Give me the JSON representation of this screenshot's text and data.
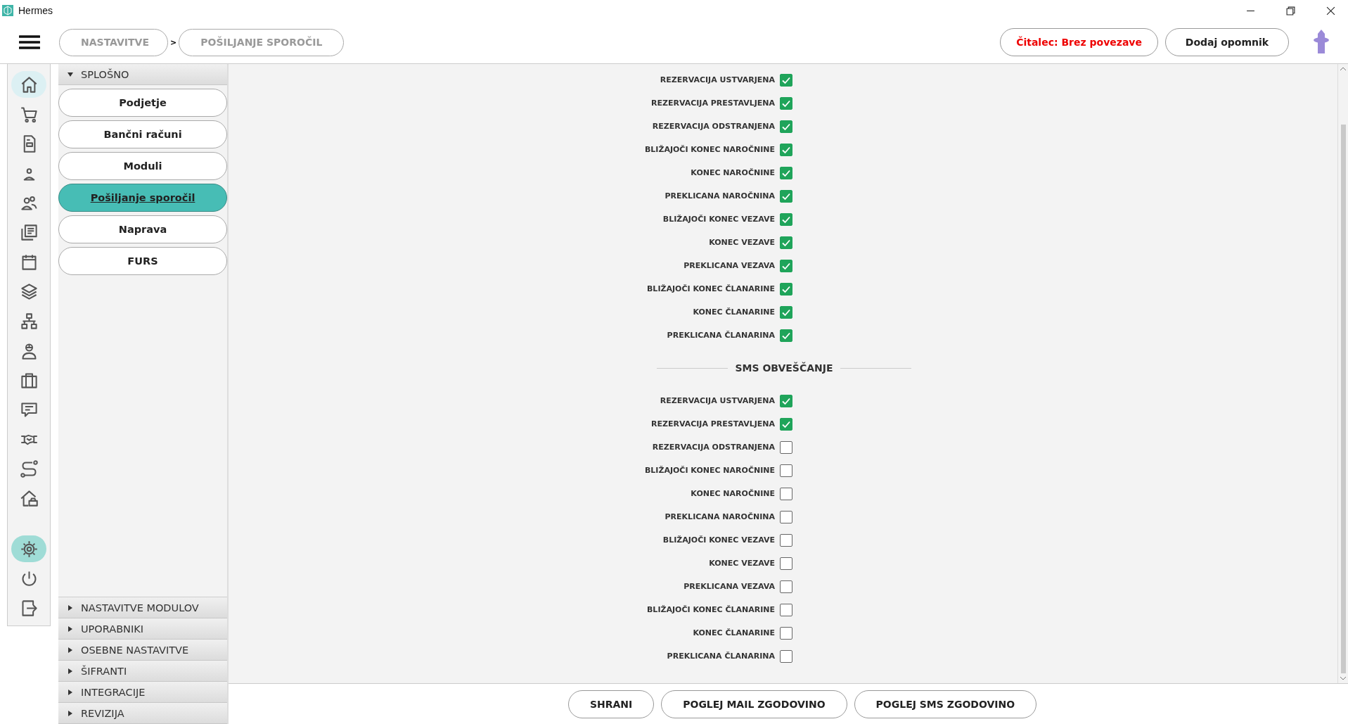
{
  "window": {
    "title": "Hermes"
  },
  "breadcrumbs": [
    {
      "label": "NASTAVITVE"
    },
    {
      "label": "POŠILJANJE SPOROČIL"
    }
  ],
  "breadcrumb_separator": ">",
  "header_buttons": [
    {
      "label": "Čitalec: Brez povezave",
      "kind": "alert"
    },
    {
      "label": "Dodaj opomnik",
      "kind": "normal"
    }
  ],
  "nav_rail": [
    {
      "kind": "home",
      "hovered": true,
      "selected": false
    },
    {
      "kind": "cart",
      "hovered": false,
      "selected": false
    },
    {
      "kind": "document",
      "hovered": false,
      "selected": false
    },
    {
      "kind": "person",
      "hovered": false,
      "selected": false
    },
    {
      "kind": "people",
      "hovered": false,
      "selected": false
    },
    {
      "kind": "news",
      "hovered": false,
      "selected": false
    },
    {
      "kind": "calendar",
      "hovered": false,
      "selected": false
    },
    {
      "kind": "layers",
      "hovered": false,
      "selected": false
    },
    {
      "kind": "network",
      "hovered": false,
      "selected": false
    },
    {
      "kind": "worker",
      "hovered": false,
      "selected": false
    },
    {
      "kind": "briefcase",
      "hovered": false,
      "selected": false
    },
    {
      "kind": "chat",
      "hovered": false,
      "selected": false
    },
    {
      "kind": "handshake",
      "hovered": false,
      "selected": false
    },
    {
      "kind": "route",
      "hovered": false,
      "selected": false
    },
    {
      "kind": "housecar",
      "hovered": false,
      "selected": false
    }
  ],
  "nav_rail_bottom": [
    {
      "kind": "gear",
      "hovered": false,
      "selected": true
    },
    {
      "kind": "power",
      "hovered": false,
      "selected": false
    },
    {
      "kind": "logout",
      "hovered": false,
      "selected": false
    }
  ],
  "settings_sections": [
    {
      "label": "SPLOŠNO",
      "expanded": true,
      "items": [
        {
          "label": "Podjetje",
          "selected": false
        },
        {
          "label": "Bančni računi",
          "selected": false
        },
        {
          "label": "Moduli",
          "selected": false
        },
        {
          "label": "Pošiljanje sporočil",
          "selected": true
        },
        {
          "label": "Naprava",
          "selected": false
        },
        {
          "label": "FURS",
          "selected": false
        }
      ]
    },
    {
      "label": "NASTAVITVE MODULOV",
      "expanded": false
    },
    {
      "label": "UPORABNIKI",
      "expanded": false
    },
    {
      "label": "OSEBNE NASTAVITVE",
      "expanded": false
    },
    {
      "label": "ŠIFRANTI",
      "expanded": false
    },
    {
      "label": "INTEGRACIJE",
      "expanded": false
    },
    {
      "label": "REVIZIJA",
      "expanded": false
    }
  ],
  "email_notifications": [
    {
      "label": "REZERVACIJA USTVARJENA",
      "checked": true
    },
    {
      "label": "REZERVACIJA PRESTAVLJENA",
      "checked": true
    },
    {
      "label": "REZERVACIJA ODSTRANJENA",
      "checked": true
    },
    {
      "label": "BLIŽAJOČI KONEC NAROČNINE",
      "checked": true
    },
    {
      "label": "KONEC NAROČNINE",
      "checked": true
    },
    {
      "label": "PREKLICANA NAROČNINA",
      "checked": true
    },
    {
      "label": "BLIŽAJOČI KONEC VEZAVE",
      "checked": true
    },
    {
      "label": "KONEC VEZAVE",
      "checked": true
    },
    {
      "label": "PREKLICANA VEZAVA",
      "checked": true
    },
    {
      "label": "BLIŽAJOČI KONEC ČLANARINE",
      "checked": true
    },
    {
      "label": "KONEC ČLANARINE",
      "checked": true
    },
    {
      "label": "PREKLICANA ČLANARINA",
      "checked": true
    }
  ],
  "sms_heading": "SMS OBVEŠČANJE",
  "sms_notifications": [
    {
      "label": "REZERVACIJA USTVARJENA",
      "checked": true
    },
    {
      "label": "REZERVACIJA PRESTAVLJENA",
      "checked": true
    },
    {
      "label": "REZERVACIJA ODSTRANJENA",
      "checked": false
    },
    {
      "label": "BLIŽAJOČI KONEC NAROČNINE",
      "checked": false
    },
    {
      "label": "KONEC NAROČNINE",
      "checked": false
    },
    {
      "label": "PREKLICANA NAROČNINA",
      "checked": false
    },
    {
      "label": "BLIŽAJOČI KONEC VEZAVE",
      "checked": false
    },
    {
      "label": "KONEC VEZAVE",
      "checked": false
    },
    {
      "label": "PREKLICANA VEZAVA",
      "checked": false
    },
    {
      "label": "BLIŽAJOČI KONEC ČLANARINE",
      "checked": false
    },
    {
      "label": "KONEC ČLANARINE",
      "checked": false
    },
    {
      "label": "PREKLICANA ČLANARINA",
      "checked": false
    }
  ],
  "actions": [
    {
      "label": "SHRANI"
    },
    {
      "label": "POGLEJ MAIL ZGODOVINO"
    },
    {
      "label": "POGLEJ SMS ZGODOVINO"
    }
  ]
}
